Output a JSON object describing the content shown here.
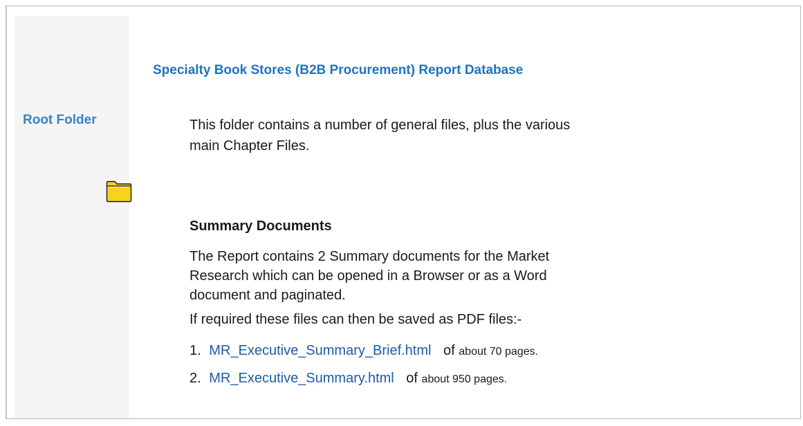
{
  "sidebar": {
    "root_label": "Root Folder",
    "folder_icon": "folder-icon",
    "folder_color": "#f7d31a"
  },
  "main": {
    "title": "Specialty Book Stores (B2B Procurement) Report Database",
    "intro": "This folder contains a number of general files, plus the various main Chapter Files.",
    "summary_heading": "Summary Documents",
    "summary_description": "The Report contains 2 Summary documents for the Market Research which can be opened in a Browser or as a Word document and paginated.",
    "pdf_note": "If required these files can then be saved as PDF files:-",
    "documents": [
      {
        "number": "1.",
        "link": "MR_Executive_Summary_Brief.html",
        "of_text": "of",
        "pages": "about 70 pages."
      },
      {
        "number": "2.",
        "link": "MR_Executive_Summary.html",
        "of_text": "of",
        "pages": "about 950 pages."
      }
    ]
  },
  "colors": {
    "title_blue": "#1f73bd",
    "link_blue": "#1f5aa6",
    "sidebar_bg": "#f5f5f5"
  }
}
